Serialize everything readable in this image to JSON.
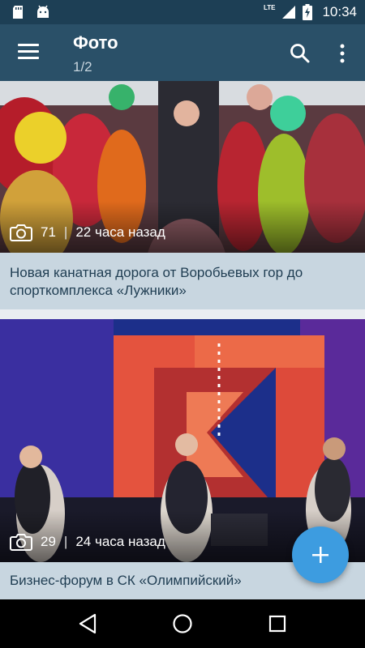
{
  "status_bar": {
    "time": "10:34",
    "network": "LTE",
    "icons": [
      "sd-card-icon",
      "android-icon",
      "signal-icon",
      "battery-charging-icon"
    ]
  },
  "app_bar": {
    "title": "Фото",
    "subtitle": "1/2",
    "icons": [
      "menu-icon",
      "search-icon",
      "more-vert-icon"
    ]
  },
  "feed": {
    "items": [
      {
        "photo_count": "71",
        "separator": "|",
        "time_ago": "22 часа назад",
        "caption": "Новая канатная дорога от Воробьевых гор до спорткомплекса «Лужники»"
      },
      {
        "photo_count": "29",
        "separator": "|",
        "time_ago": "24 часа назад",
        "caption": "Бизнес-форум в СК «Олимпийский»"
      }
    ]
  },
  "fab": {
    "icon": "plus-icon"
  },
  "nav_bar": {
    "icons": [
      "back-icon",
      "home-icon",
      "recents-icon"
    ]
  },
  "colors": {
    "status_bar": "#1d3f55",
    "app_bar": "#2a5068",
    "caption_bg": "#c8d6e0",
    "caption_text": "#1f3d52",
    "fab": "#3d9ce0"
  }
}
